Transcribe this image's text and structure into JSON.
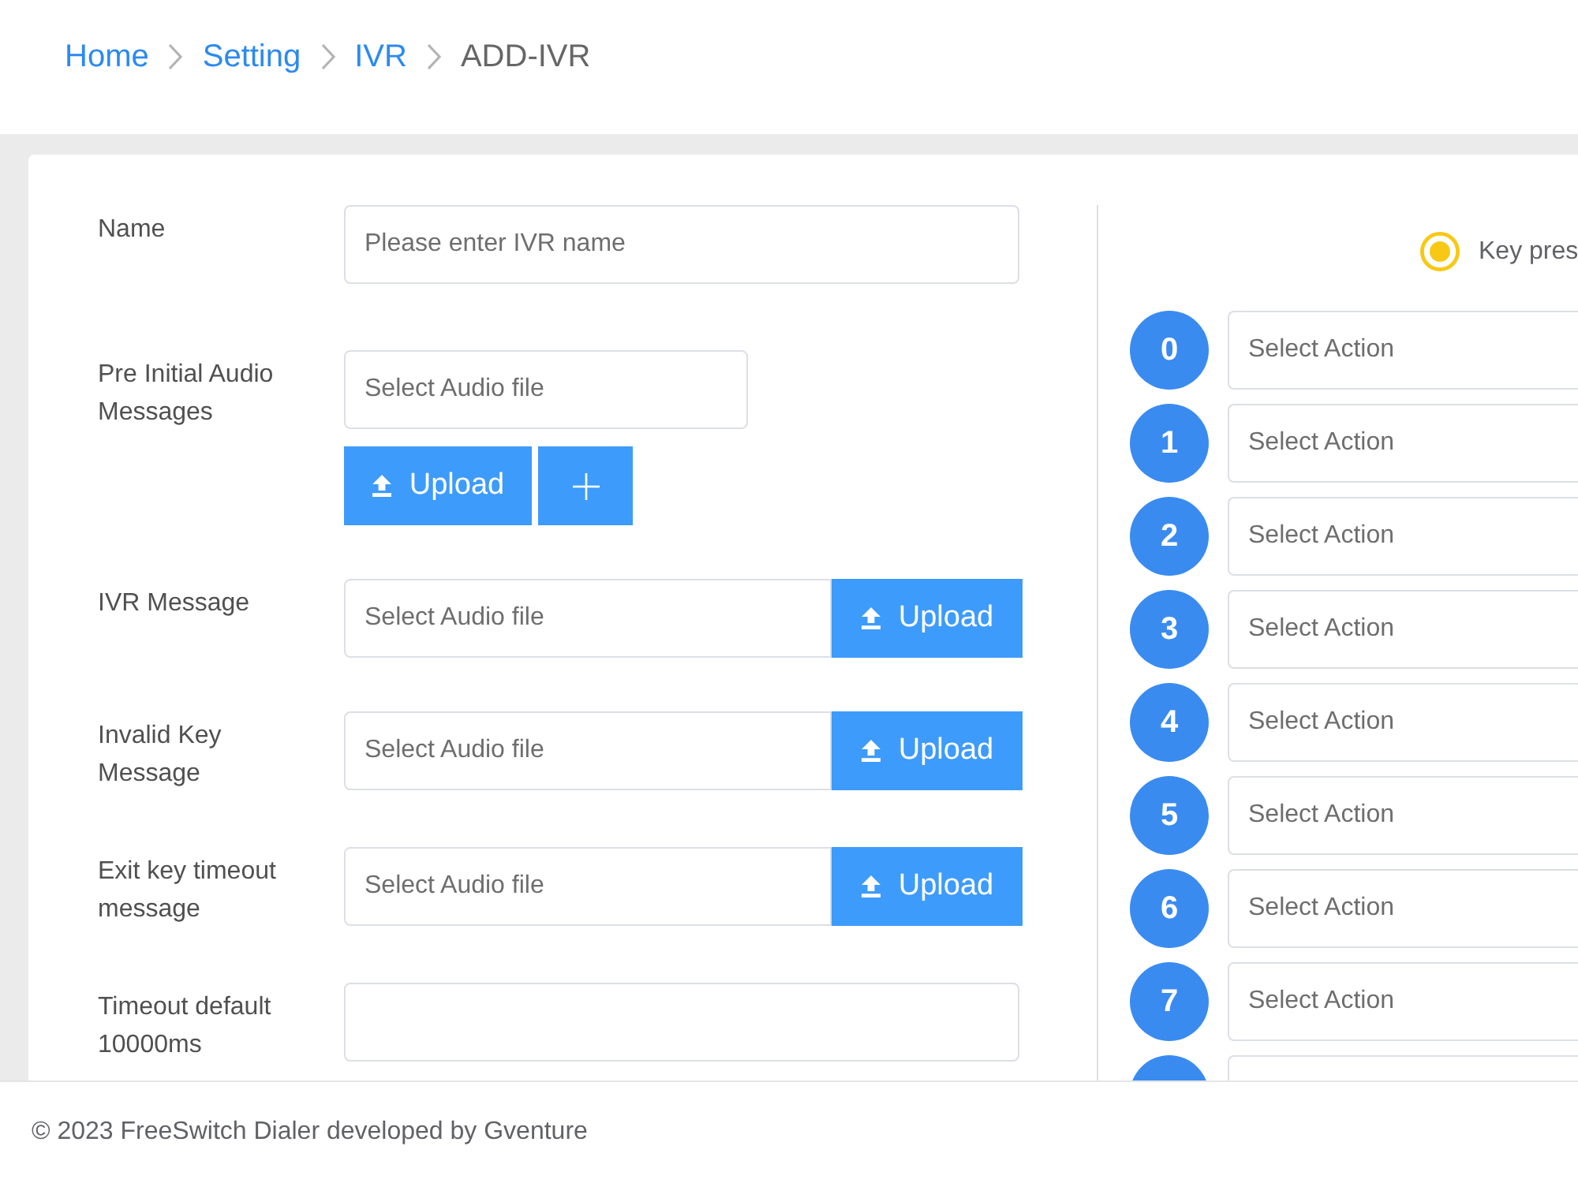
{
  "breadcrumb": [
    {
      "label": "Home",
      "current": false
    },
    {
      "label": "Setting",
      "current": false
    },
    {
      "label": "IVR",
      "current": false
    },
    {
      "label": "ADD-IVR",
      "current": true
    }
  ],
  "form": {
    "fields": [
      {
        "kind": "text",
        "label": "Name",
        "placeholder": "Please enter IVR name"
      },
      {
        "kind": "audio_stacked",
        "label": "Pre Initial Audio Messages",
        "placeholder": "Select Audio file",
        "upload_button": "Upload",
        "add_button": true
      },
      {
        "kind": "audio_inline",
        "label": "IVR Message",
        "placeholder": "Select Audio file",
        "upload_button": "Upload"
      },
      {
        "kind": "audio_inline",
        "label": "Invalid Key Message",
        "placeholder": "Select Audio file",
        "upload_button": "Upload"
      },
      {
        "kind": "audio_inline",
        "label": "Exit key timeout message",
        "placeholder": "Select Audio file",
        "upload_button": "Upload"
      },
      {
        "kind": "text",
        "label": "Timeout default 10000ms"
      }
    ]
  },
  "key_panel": {
    "mode_options": [
      {
        "label": "Key pres",
        "selected": true
      }
    ],
    "keys": [
      {
        "digit": "0",
        "placeholder": "Select Action"
      },
      {
        "digit": "1",
        "placeholder": "Select Action"
      },
      {
        "digit": "2",
        "placeholder": "Select Action"
      },
      {
        "digit": "3",
        "placeholder": "Select Action"
      },
      {
        "digit": "4",
        "placeholder": "Select Action"
      },
      {
        "digit": "5",
        "placeholder": "Select Action"
      },
      {
        "digit": "6",
        "placeholder": "Select Action"
      },
      {
        "digit": "7",
        "placeholder": "Select Action"
      }
    ],
    "cut_off_row": true
  },
  "footer": {
    "text": "© 2023 FreeSwitch Dialer developed by Gventure"
  }
}
